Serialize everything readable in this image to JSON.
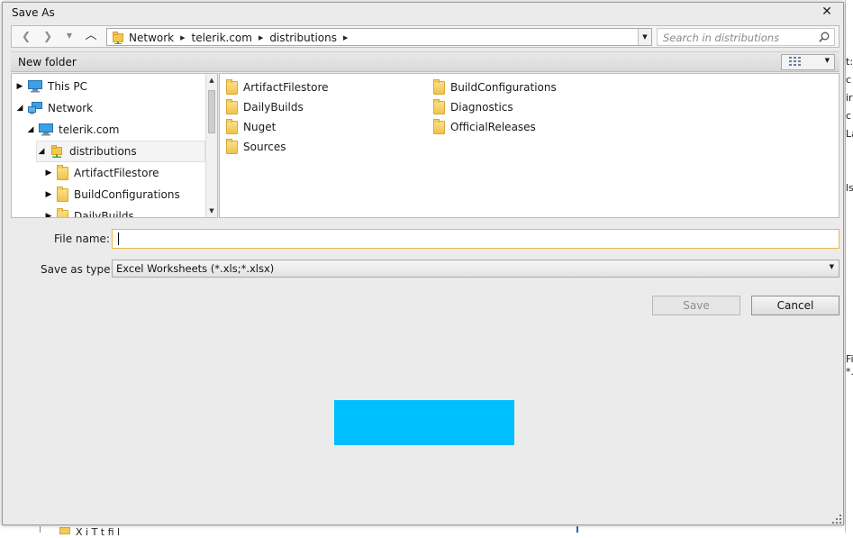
{
  "window": {
    "title": "Save As"
  },
  "nav": {
    "crumbs": [
      "Network",
      "telerik.com",
      "distributions"
    ],
    "search_placeholder": "Search in distributions"
  },
  "toolbar": {
    "new_folder": "New folder"
  },
  "tree": {
    "items": [
      {
        "label": "This PC",
        "expander": "▶",
        "icon": "computer-icon"
      },
      {
        "label": "Network",
        "expander": "◢",
        "icon": "network-icon"
      },
      {
        "label": "telerik.com",
        "expander": "◢",
        "icon": "computer-icon"
      },
      {
        "label": "distributions",
        "expander": "◢",
        "icon": "network-folder-icon"
      },
      {
        "label": "ArtifactFilestore",
        "expander": "▶",
        "icon": "folder-icon"
      },
      {
        "label": "BuildConfigurations",
        "expander": "▶",
        "icon": "folder-icon"
      },
      {
        "label": "DailyBuilds",
        "expander": "▶",
        "icon": "folder-icon"
      }
    ]
  },
  "files": {
    "items": [
      "ArtifactFilestore",
      "DailyBuilds",
      "Nuget",
      "Sources",
      "BuildConfigurations",
      "Diagnostics",
      "OfficialReleases"
    ]
  },
  "form": {
    "file_name_label": "File name:",
    "file_name_value": "",
    "save_type_label": "Save as type:",
    "save_type_value": "Excel Worksheets (*.xls;*.xlsx)"
  },
  "buttons": {
    "save": "Save",
    "cancel": "Cancel"
  },
  "background": {
    "right_fragments": [
      "t:",
      "c",
      "ir",
      "c",
      "La",
      "ls",
      "Fi",
      "*."
    ],
    "bottom_fragment": "X      i  T  t fi  l"
  },
  "colors": {
    "accent_block": "#00bfff",
    "dialog_bg": "#ebebeb",
    "folder": "#f0c24d",
    "focus_border": "#e8b94a"
  }
}
